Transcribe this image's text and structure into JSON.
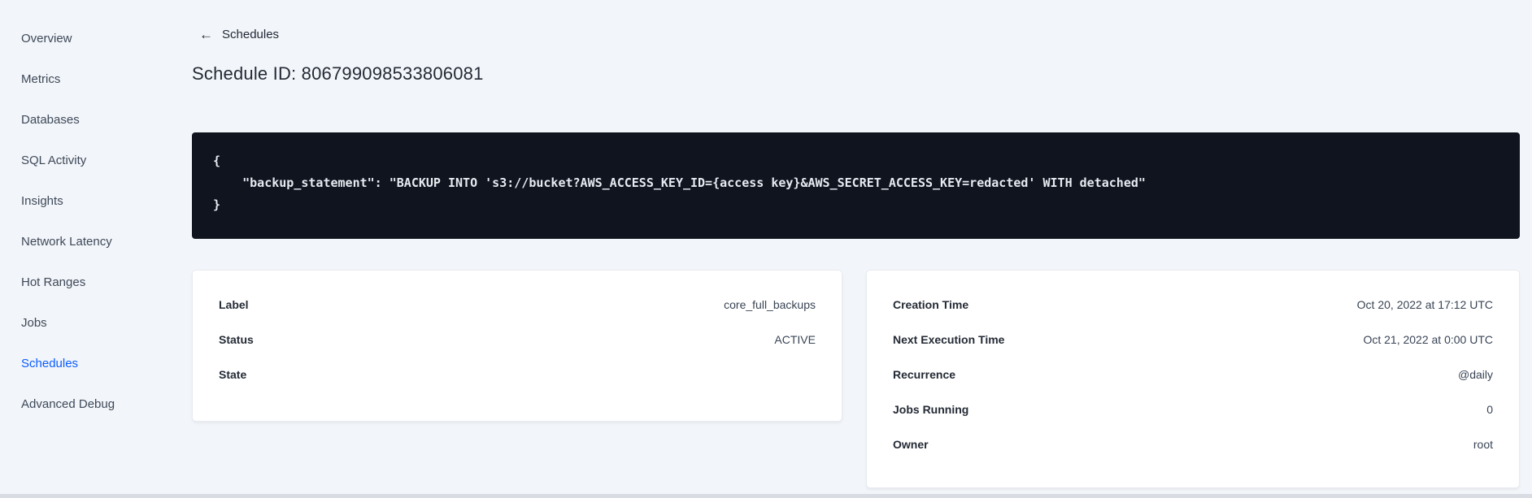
{
  "colors": {
    "page_bg": "#f2f5f9",
    "accent_blue": "#0b5cff",
    "code_bg": "#10141e",
    "code_text": "#e6eaf1"
  },
  "sidebar": {
    "items": [
      {
        "label": "Overview",
        "active": false
      },
      {
        "label": "Metrics",
        "active": false
      },
      {
        "label": "Databases",
        "active": false
      },
      {
        "label": "SQL Activity",
        "active": false
      },
      {
        "label": "Insights",
        "active": false
      },
      {
        "label": "Network Latency",
        "active": false
      },
      {
        "label": "Hot Ranges",
        "active": false
      },
      {
        "label": "Jobs",
        "active": false
      },
      {
        "label": "Schedules",
        "active": true
      },
      {
        "label": "Advanced Debug",
        "active": false
      }
    ]
  },
  "main": {
    "back_link": {
      "arrow_glyph": "←",
      "label": "Schedules"
    },
    "page_title": "Schedule ID: 806799098533806081",
    "code_block": {
      "text": "{\n    \"backup_statement\": \"BACKUP INTO 's3://bucket?AWS_ACCESS_KEY_ID={access key}&AWS_SECRET_ACCESS_KEY=redacted' WITH detached\"\n}"
    },
    "details_card": {
      "rows": [
        {
          "label": "Label",
          "value": "core_full_backups"
        },
        {
          "label": "Status",
          "value": "ACTIVE"
        },
        {
          "label": "State",
          "value": ""
        }
      ]
    },
    "schedule_card": {
      "rows": [
        {
          "label": "Creation Time",
          "value": "Oct 20, 2022 at 17:12 UTC"
        },
        {
          "label": "Next Execution Time",
          "value": "Oct 21, 2022 at 0:00 UTC"
        },
        {
          "label": "Recurrence",
          "value": "@daily"
        },
        {
          "label": "Jobs Running",
          "value": "0"
        },
        {
          "label": "Owner",
          "value": "root"
        }
      ]
    }
  }
}
